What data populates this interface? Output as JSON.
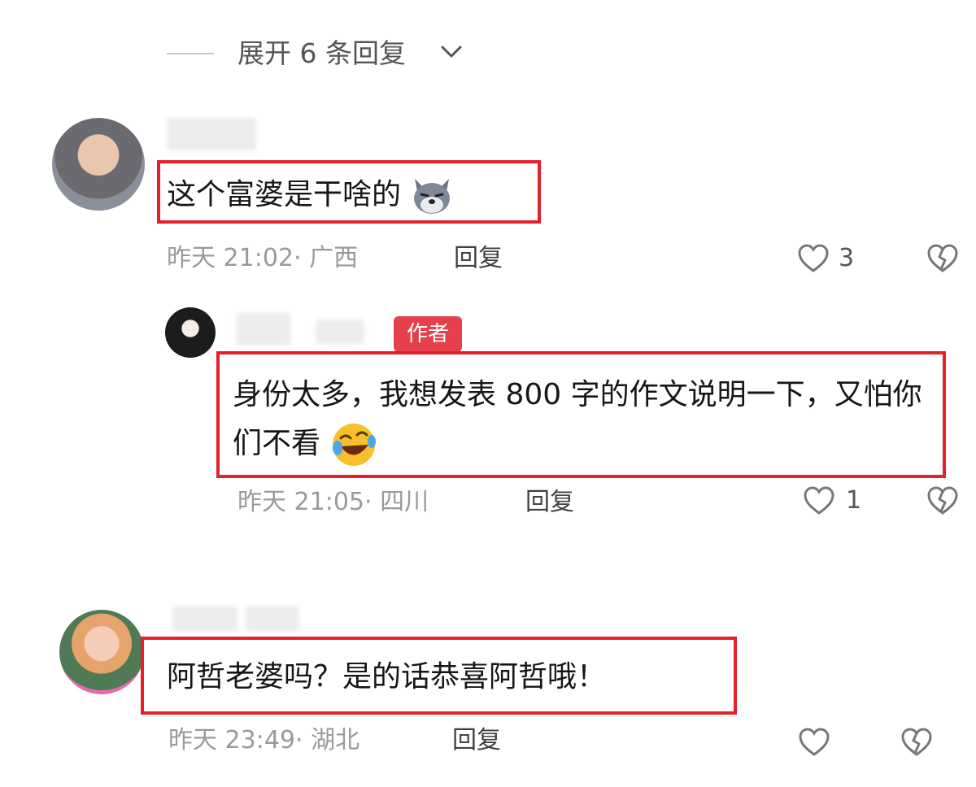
{
  "expand": {
    "label": "展开 6 条回复"
  },
  "comments": [
    {
      "text": "这个富婆是干啥的",
      "emoji": "wolf-face-emoji",
      "time_location": "昨天 21:02· 广西",
      "reply_label": "回复",
      "likes": "3"
    },
    {
      "badge": "作者",
      "text": "身份太多，我想发表 800 字的作文说明一下，又怕你们不看",
      "emoji": "rolling-laughing-emoji",
      "time_location": "昨天 21:05· 四川",
      "reply_label": "回复",
      "likes": "1"
    },
    {
      "text": "阿哲老婆吗？是的话恭喜阿哲哦！",
      "time_location": "昨天 23:49· 湖北",
      "reply_label": "回复",
      "likes": ""
    }
  ],
  "colors": {
    "highlight_frame": "#e5202b",
    "author_badge": "#e5404b",
    "meta_text": "#9a9a9a"
  }
}
